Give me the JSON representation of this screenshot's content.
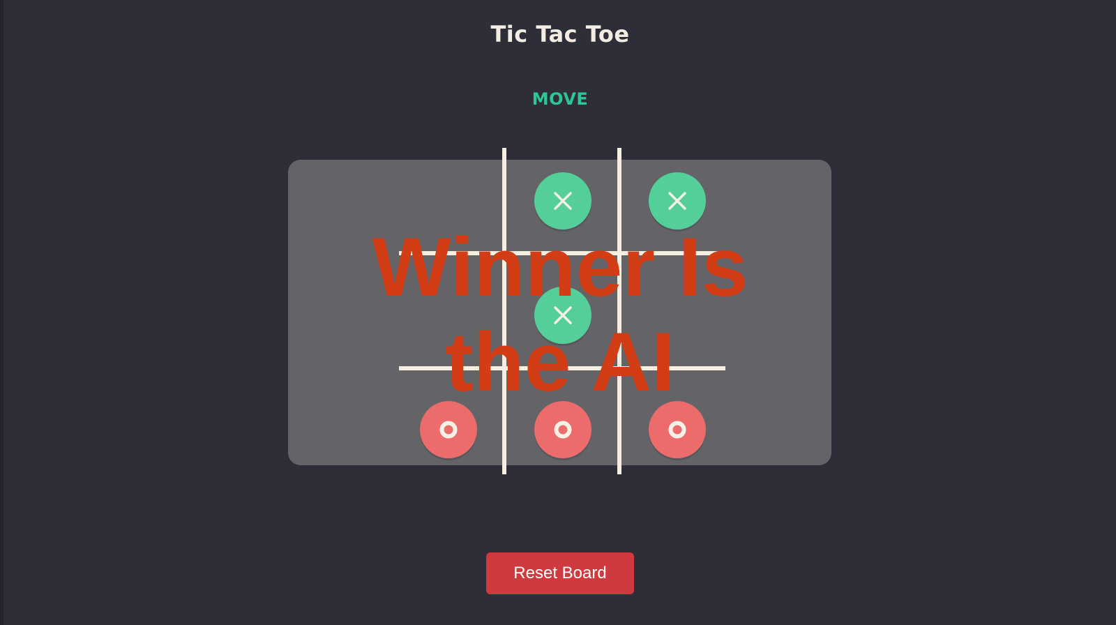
{
  "app": {
    "title": "Tic Tac Toe",
    "status": "MOVE"
  },
  "board": {
    "cells": [
      "",
      "X",
      "X",
      "",
      "X",
      "",
      "O",
      "O",
      "O"
    ],
    "x_icon": "close-icon",
    "o_icon": "ring-icon"
  },
  "result": {
    "message": "Winner Is the AI"
  },
  "controls": {
    "reset_label": "Reset Board"
  },
  "colors": {
    "background": "#2e2e39",
    "status": "#2dc795",
    "x_piece": "#55cf9a",
    "o_piece": "#ec6c6c",
    "winner_text": "#d23d16",
    "reset_button": "#cf3a3f"
  }
}
